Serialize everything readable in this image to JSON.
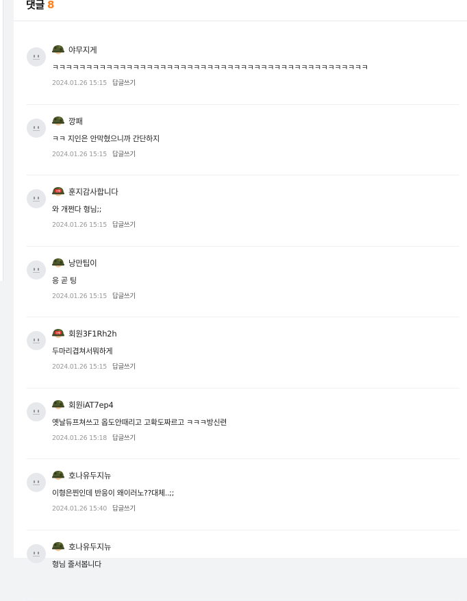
{
  "header": {
    "title": "댓글",
    "count": "8"
  },
  "reply_label": "답글쓰기",
  "colors": {
    "accent": "#ff7f1e",
    "helmet": "#4f5a2c",
    "badge": "#d9342b"
  },
  "comments": [
    {
      "nickname": "야무지게",
      "rank_icon": "helmet-icon",
      "text": "ㅋㅋㅋㅋㅋㅋㅋㅋㅋㅋㅋㅋㅋㅋㅋㅋㅋㅋㅋㅋㅋㅋㅋㅋㅋㅋㅋㅋㅋㅋㅋㅋㅋㅋㅋㅋㅋㅋㅋㅋㅋㅋㅋㅋㅋㅋㅋ",
      "time": "2024.01.26 15:15"
    },
    {
      "nickname": "깡패",
      "rank_icon": "helmet-icon",
      "text": "ㅋㅋ 지인은 안막혔으니까 간단하지",
      "time": "2024.01.26 15:15"
    },
    {
      "nickname": "훈지감사합니다",
      "rank_icon": "recruit-helmet-icon",
      "text": "와 개쩐다 형님;;",
      "time": "2024.01.26 15:15"
    },
    {
      "nickname": "낭만팁이",
      "rank_icon": "helmet-icon",
      "text": "응 곧 팅",
      "time": "2024.01.26 15:15"
    },
    {
      "nickname": "회원3F1Rh2h",
      "rank_icon": "recruit-helmet-icon",
      "text": "두마리겹쳐서뭐하게",
      "time": "2024.01.26 15:15"
    },
    {
      "nickname": "회원iAT7ep4",
      "rank_icon": "helmet-icon",
      "text": "옛날듀프쳐쓰고 옵도안때리고 고확도짜르고 ㅋㅋㅋ방신련",
      "time": "2024.01.26 15:18"
    },
    {
      "nickname": "호나유두지뉴",
      "rank_icon": "helmet-icon",
      "text": "이형은찐인데 반응이 왜이러노??대체..;;",
      "time": "2024.01.26 15:40"
    },
    {
      "nickname": "호나유두지뉴",
      "rank_icon": "helmet-icon",
      "text": "형님 줄서봅니다",
      "time": ""
    }
  ]
}
